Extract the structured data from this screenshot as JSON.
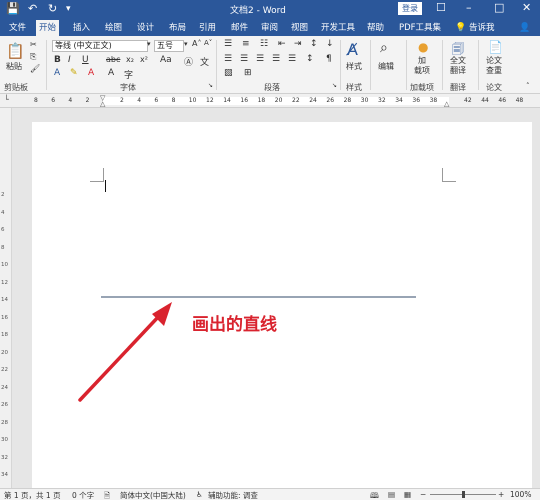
{
  "titlebar": {
    "title": "文档2 - Word",
    "login_label": "登录",
    "save_icon": "save-icon",
    "undo_icon": "undo-icon",
    "redo_icon": "redo-icon"
  },
  "tabs": [
    "文件",
    "开始",
    "插入",
    "绘图",
    "设计",
    "布局",
    "引用",
    "邮件",
    "审阅",
    "视图",
    "开发工具",
    "帮助",
    "PDF工具集",
    "告诉我"
  ],
  "active_tab": "开始",
  "ribbon": {
    "paste_label": "粘贴",
    "clipboard_label": "剪贴板",
    "font_name": "等线 (中文正文)",
    "font_size": "五号",
    "font_group_label": "字体",
    "paragraph_group_label": "段落",
    "styles_label": "样式",
    "styles_group_label": "样式",
    "edit_label": "编辑",
    "addin_label_1": "加",
    "addin_label_2": "载项",
    "addin_group_label": "加载项",
    "translate_label_1": "全文",
    "translate_label_2": "翻译",
    "translate_group_label": "翻译",
    "paper_label_1": "论文",
    "paper_label_2": "查重",
    "paper_group_label": "论文",
    "bold": "B",
    "italic": "I",
    "underline": "U",
    "strike": "abc",
    "font_color": "A"
  },
  "ruler": {
    "marks": [
      "8",
      "6",
      "4",
      "2",
      "",
      "2",
      "4",
      "6",
      "8",
      "10",
      "12",
      "14",
      "16",
      "18",
      "20",
      "22",
      "24",
      "26",
      "28",
      "30",
      "32",
      "34",
      "36",
      "38",
      "",
      "42",
      "44",
      "46",
      "48"
    ]
  },
  "vruler": {
    "marks": [
      "2",
      "4",
      "6",
      "8",
      "10",
      "12",
      "14",
      "16",
      "18",
      "20",
      "22",
      "24",
      "26",
      "28",
      "30",
      "32",
      "34",
      "36"
    ]
  },
  "document": {
    "annotation_text": "画出的直线",
    "line_color": "#5b6e87",
    "arrow_color": "#d9232e"
  },
  "statusbar": {
    "page": "第 1 页，共 1 页",
    "words": "0 个字",
    "language": "简体中文(中国大陆)",
    "accessibility": "辅助功能: 调查",
    "zoom": "100%",
    "zoom_level": 100
  }
}
